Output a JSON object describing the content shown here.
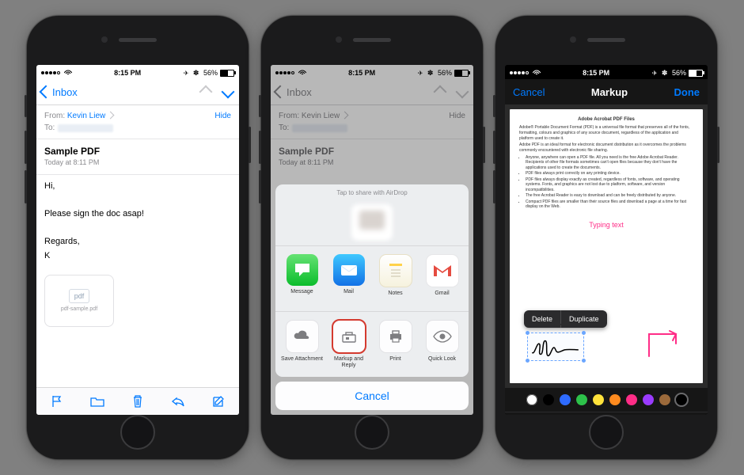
{
  "status": {
    "time": "8:15 PM",
    "battery_pct": "56%"
  },
  "phone1": {
    "nav_back": "Inbox",
    "from_label": "From:",
    "from_name": "Kevin Liew",
    "to_label": "To:",
    "hide": "Hide",
    "subject": "Sample PDF",
    "subtime": "Today at 8:11 PM",
    "body_line1": "Hi,",
    "body_line2": "Please sign the doc asap!",
    "body_line3": "Regards,",
    "body_line4": "K",
    "attach_kind": "pdf",
    "attach_name": "pdf-sample.pdf"
  },
  "phone2": {
    "nav_back": "Inbox",
    "from_label": "From:",
    "from_name": "Kevin Liew",
    "to_label": "To:",
    "hide": "Hide",
    "subject": "Sample PDF",
    "subtime": "Today at 8:11 PM",
    "airdrop_hint": "Tap to share with AirDrop",
    "apps": [
      "Message",
      "Mail",
      "Notes",
      "Gmail"
    ],
    "actions": [
      "Save Attachment",
      "Markup and Reply",
      "Print",
      "Quick Look"
    ],
    "cancel": "Cancel"
  },
  "phone3": {
    "cancel": "Cancel",
    "title": "Markup",
    "done": "Done",
    "doc_title": "Adobe Acrobat PDF Files",
    "doc_p1": "Adobe® Portable Document Format (PDF) is a universal file format that preserves all of the fonts, formatting, colours and graphics of any source document, regardless of the application and platform used to create it.",
    "doc_p2": "Adobe PDF is an ideal format for electronic document distribution as it overcomes the problems commonly encountered with electronic file sharing.",
    "doc_b1": "Anyone, anywhere can open a PDF file. All you need is the free Adobe Acrobat Reader. Recipients of other file formats sometimes can't open files because they don't have the applications used to create the documents.",
    "doc_b2": "PDF files always print correctly on any printing device.",
    "doc_b3": "PDF files always display exactly as created, regardless of fonts, software, and operating systems. Fonts, and graphics are not lost due to platform, software, and version incompatibilities.",
    "doc_b4": "The free Acrobat Reader is easy to download and can be freely distributed by anyone.",
    "doc_b5": "Compact PDF files are smaller than their source files and download a page at a time for fast display on the Web.",
    "typing": "Typing text",
    "pop_delete": "Delete",
    "pop_duplicate": "Duplicate",
    "palette": [
      "#ffffff",
      "#000000",
      "#2e6bff",
      "#2dc24a",
      "#ffe23b",
      "#ff8b1f",
      "#ff2d87",
      "#9a3bff",
      "#9c6a3b",
      "#000000"
    ],
    "palette_selected": 9
  }
}
